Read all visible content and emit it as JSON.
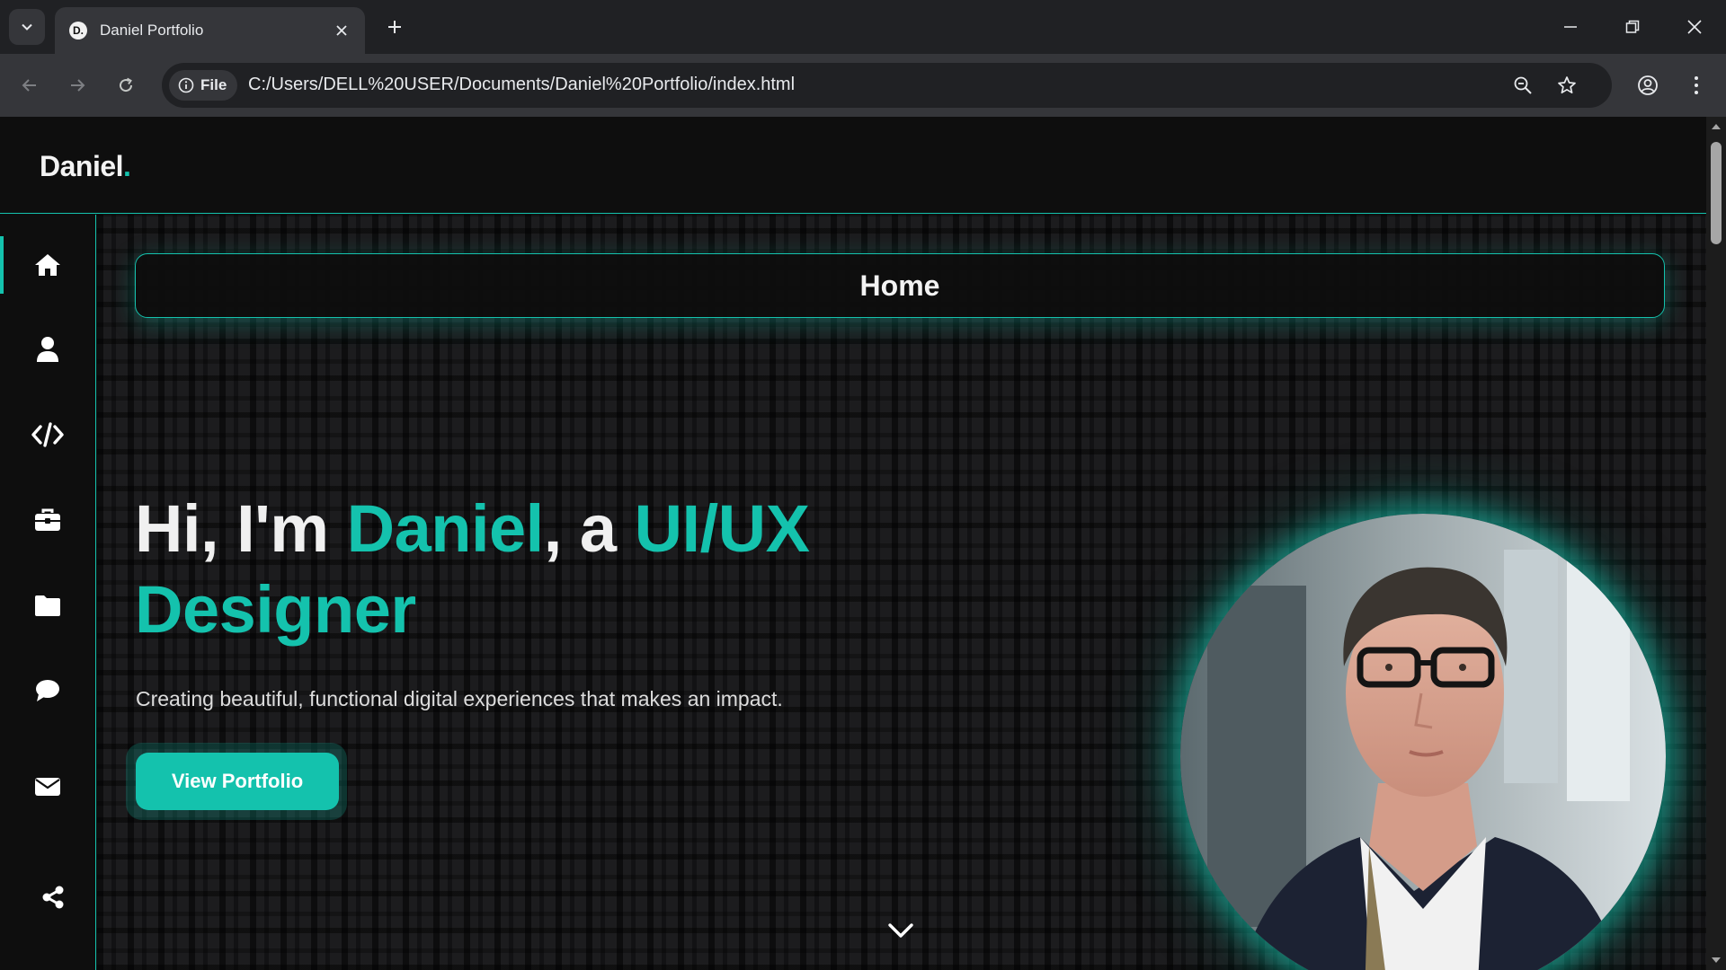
{
  "browser": {
    "tab_title": "Daniel Portfolio",
    "favicon_letter": "D.",
    "site_chip_label": "File",
    "url": "C:/Users/DELL%20USER/Documents/Daniel%20Portfolio/index.html"
  },
  "page": {
    "logo": {
      "name": "Daniel",
      "dot": "."
    },
    "accent_color": "#14c2ad",
    "sidebar": {
      "items": [
        {
          "icon": "home-icon",
          "active": true
        },
        {
          "icon": "user-icon"
        },
        {
          "icon": "code-icon"
        },
        {
          "icon": "briefcase-icon"
        },
        {
          "icon": "folder-icon"
        },
        {
          "icon": "chat-icon"
        },
        {
          "icon": "mail-icon"
        },
        {
          "icon": "share-icon"
        }
      ]
    },
    "section_title": "Home",
    "hero": {
      "greeting": "Hi, I'm ",
      "name": "Daniel",
      "connector": ", a ",
      "role": "UI/UX Designer",
      "subtitle": "Creating beautiful, functional digital experiences that makes an impact.",
      "cta_label": "View Portfolio"
    }
  }
}
